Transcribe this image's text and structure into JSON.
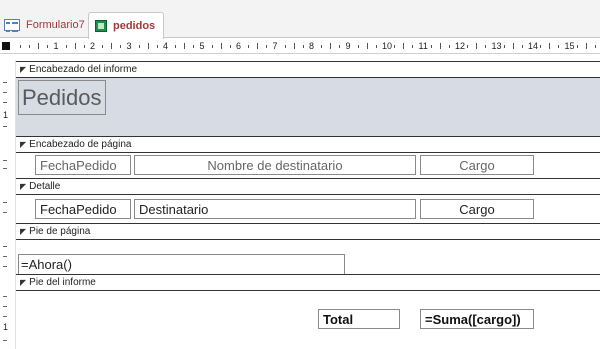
{
  "tabs": [
    {
      "label": "Formulario7"
    },
    {
      "label": "pedidos"
    }
  ],
  "ruler": {
    "numbers": [
      "1",
      "2",
      "3",
      "4",
      "5",
      "6",
      "7",
      "8",
      "9",
      "10",
      "11",
      "12",
      "13",
      "14",
      "15"
    ]
  },
  "vruler": {
    "numbers": [
      "1",
      "1"
    ]
  },
  "sections": {
    "report_header": {
      "label": "Encabezado del informe",
      "title": "Pedidos"
    },
    "page_header": {
      "label": "Encabezado de página",
      "col1": "FechaPedido",
      "col2": "Nombre de destinatario",
      "col3": "Cargo"
    },
    "detail": {
      "label": "Detalle",
      "col1": "FechaPedido",
      "col2": "Destinatario",
      "col3": "Cargo"
    },
    "page_footer": {
      "label": "Pie de página",
      "expr": "=Ahora()"
    },
    "report_footer": {
      "label": "Pie del informe",
      "total_label": "Total",
      "total_expr": "=Suma([cargo])"
    }
  },
  "colors": {
    "header_band": "#d6dbe4",
    "tab_text": "#a4373a"
  }
}
